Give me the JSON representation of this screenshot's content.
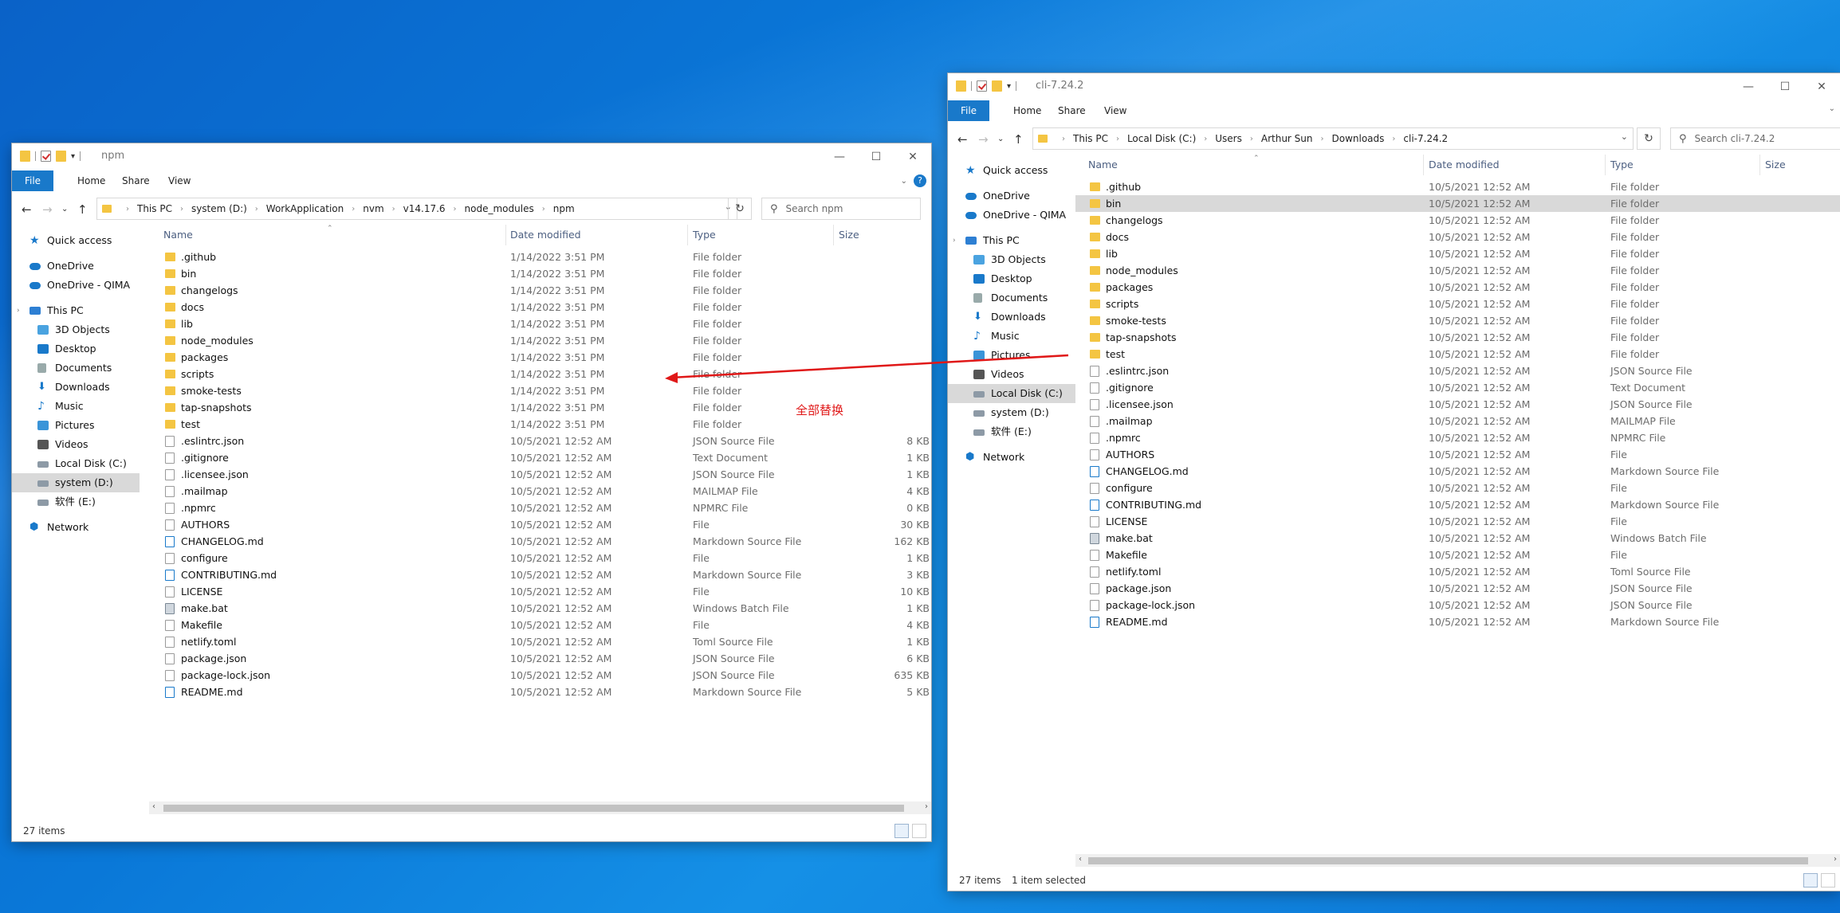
{
  "annotation": {
    "text": "全部替换"
  },
  "left_window": {
    "title": "npm",
    "ribbon_tabs": [
      "File",
      "Home",
      "Share",
      "View"
    ],
    "breadcrumb": [
      "This PC",
      "system (D:)",
      "WorkApplication",
      "nvm",
      "v14.17.6",
      "node_modules",
      "npm"
    ],
    "search_placeholder": "Search npm",
    "columns": [
      "Name",
      "Date modified",
      "Type",
      "Size"
    ],
    "status": "27 items",
    "nav": [
      {
        "label": "Quick access",
        "icon": "star-icon",
        "level": 0
      },
      {
        "label": "OneDrive",
        "icon": "cloud-icon",
        "level": 0
      },
      {
        "label": "OneDrive - QIMA",
        "icon": "cloud-icon",
        "level": 0
      },
      {
        "label": "This PC",
        "icon": "computer-icon",
        "level": 0
      },
      {
        "label": "3D Objects",
        "icon": "cube-icon",
        "level": 1
      },
      {
        "label": "Desktop",
        "icon": "desktop-icon",
        "level": 1
      },
      {
        "label": "Documents",
        "icon": "document-icon",
        "level": 1
      },
      {
        "label": "Downloads",
        "icon": "download-icon",
        "level": 1
      },
      {
        "label": "Music",
        "icon": "music-icon",
        "level": 1
      },
      {
        "label": "Pictures",
        "icon": "picture-icon",
        "level": 1
      },
      {
        "label": "Videos",
        "icon": "video-icon",
        "level": 1
      },
      {
        "label": "Local Disk (C:)",
        "icon": "drive-icon",
        "level": 1
      },
      {
        "label": "system (D:)",
        "icon": "drive-icon",
        "level": 1,
        "selected": true
      },
      {
        "label": "软件 (E:)",
        "icon": "drive-icon",
        "level": 1
      },
      {
        "label": "Network",
        "icon": "network-icon",
        "level": 0
      }
    ],
    "files": [
      {
        "name": ".github",
        "date": "1/14/2022 3:51 PM",
        "type": "File folder",
        "size": "",
        "kind": "folder"
      },
      {
        "name": "bin",
        "date": "1/14/2022 3:51 PM",
        "type": "File folder",
        "size": "",
        "kind": "folder"
      },
      {
        "name": "changelogs",
        "date": "1/14/2022 3:51 PM",
        "type": "File folder",
        "size": "",
        "kind": "folder"
      },
      {
        "name": "docs",
        "date": "1/14/2022 3:51 PM",
        "type": "File folder",
        "size": "",
        "kind": "folder"
      },
      {
        "name": "lib",
        "date": "1/14/2022 3:51 PM",
        "type": "File folder",
        "size": "",
        "kind": "folder"
      },
      {
        "name": "node_modules",
        "date": "1/14/2022 3:51 PM",
        "type": "File folder",
        "size": "",
        "kind": "folder"
      },
      {
        "name": "packages",
        "date": "1/14/2022 3:51 PM",
        "type": "File folder",
        "size": "",
        "kind": "folder"
      },
      {
        "name": "scripts",
        "date": "1/14/2022 3:51 PM",
        "type": "File folder",
        "size": "",
        "kind": "folder"
      },
      {
        "name": "smoke-tests",
        "date": "1/14/2022 3:51 PM",
        "type": "File folder",
        "size": "",
        "kind": "folder"
      },
      {
        "name": "tap-snapshots",
        "date": "1/14/2022 3:51 PM",
        "type": "File folder",
        "size": "",
        "kind": "folder"
      },
      {
        "name": "test",
        "date": "1/14/2022 3:51 PM",
        "type": "File folder",
        "size": "",
        "kind": "folder"
      },
      {
        "name": ".eslintrc.json",
        "date": "10/5/2021 12:52 AM",
        "type": "JSON Source File",
        "size": "8 KB",
        "kind": "json"
      },
      {
        "name": ".gitignore",
        "date": "10/5/2021 12:52 AM",
        "type": "Text Document",
        "size": "1 KB",
        "kind": "file"
      },
      {
        "name": ".licensee.json",
        "date": "10/5/2021 12:52 AM",
        "type": "JSON Source File",
        "size": "1 KB",
        "kind": "json"
      },
      {
        "name": ".mailmap",
        "date": "10/5/2021 12:52 AM",
        "type": "MAILMAP File",
        "size": "4 KB",
        "kind": "file"
      },
      {
        "name": ".npmrc",
        "date": "10/5/2021 12:52 AM",
        "type": "NPMRC File",
        "size": "0 KB",
        "kind": "file"
      },
      {
        "name": "AUTHORS",
        "date": "10/5/2021 12:52 AM",
        "type": "File",
        "size": "30 KB",
        "kind": "file"
      },
      {
        "name": "CHANGELOG.md",
        "date": "10/5/2021 12:52 AM",
        "type": "Markdown Source File",
        "size": "162 KB",
        "kind": "md"
      },
      {
        "name": "configure",
        "date": "10/5/2021 12:52 AM",
        "type": "File",
        "size": "1 KB",
        "kind": "file"
      },
      {
        "name": "CONTRIBUTING.md",
        "date": "10/5/2021 12:52 AM",
        "type": "Markdown Source File",
        "size": "3 KB",
        "kind": "md"
      },
      {
        "name": "LICENSE",
        "date": "10/5/2021 12:52 AM",
        "type": "File",
        "size": "10 KB",
        "kind": "file"
      },
      {
        "name": "make.bat",
        "date": "10/5/2021 12:52 AM",
        "type": "Windows Batch File",
        "size": "1 KB",
        "kind": "bat"
      },
      {
        "name": "Makefile",
        "date": "10/5/2021 12:52 AM",
        "type": "File",
        "size": "4 KB",
        "kind": "file"
      },
      {
        "name": "netlify.toml",
        "date": "10/5/2021 12:52 AM",
        "type": "Toml Source File",
        "size": "1 KB",
        "kind": "file"
      },
      {
        "name": "package.json",
        "date": "10/5/2021 12:52 AM",
        "type": "JSON Source File",
        "size": "6 KB",
        "kind": "json"
      },
      {
        "name": "package-lock.json",
        "date": "10/5/2021 12:52 AM",
        "type": "JSON Source File",
        "size": "635 KB",
        "kind": "json"
      },
      {
        "name": "README.md",
        "date": "10/5/2021 12:52 AM",
        "type": "Markdown Source File",
        "size": "5 KB",
        "kind": "md"
      }
    ]
  },
  "right_window": {
    "title": "cli-7.24.2",
    "ribbon_tabs": [
      "File",
      "Home",
      "Share",
      "View"
    ],
    "breadcrumb": [
      "This PC",
      "Local Disk (C:)",
      "Users",
      "Arthur Sun",
      "Downloads",
      "cli-7.24.2"
    ],
    "search_placeholder": "Search cli-7.24.2",
    "columns": [
      "Name",
      "Date modified",
      "Type",
      "Size"
    ],
    "status": "27 items",
    "status_selected": "1 item selected",
    "nav": [
      {
        "label": "Quick access",
        "icon": "star-icon",
        "level": 0
      },
      {
        "label": "OneDrive",
        "icon": "cloud-icon",
        "level": 0
      },
      {
        "label": "OneDrive - QIMA",
        "icon": "cloud-icon",
        "level": 0
      },
      {
        "label": "This PC",
        "icon": "computer-icon",
        "level": 0
      },
      {
        "label": "3D Objects",
        "icon": "cube-icon",
        "level": 1
      },
      {
        "label": "Desktop",
        "icon": "desktop-icon",
        "level": 1
      },
      {
        "label": "Documents",
        "icon": "document-icon",
        "level": 1
      },
      {
        "label": "Downloads",
        "icon": "download-icon",
        "level": 1
      },
      {
        "label": "Music",
        "icon": "music-icon",
        "level": 1
      },
      {
        "label": "Pictures",
        "icon": "picture-icon",
        "level": 1
      },
      {
        "label": "Videos",
        "icon": "video-icon",
        "level": 1
      },
      {
        "label": "Local Disk (C:)",
        "icon": "drive-icon",
        "level": 1,
        "selected": true
      },
      {
        "label": "system (D:)",
        "icon": "drive-icon",
        "level": 1
      },
      {
        "label": "软件 (E:)",
        "icon": "drive-icon",
        "level": 1
      },
      {
        "label": "Network",
        "icon": "network-icon",
        "level": 0
      }
    ],
    "files": [
      {
        "name": ".github",
        "date": "10/5/2021 12:52 AM",
        "type": "File folder",
        "kind": "folder"
      },
      {
        "name": "bin",
        "date": "10/5/2021 12:52 AM",
        "type": "File folder",
        "kind": "folder",
        "selected": true
      },
      {
        "name": "changelogs",
        "date": "10/5/2021 12:52 AM",
        "type": "File folder",
        "kind": "folder"
      },
      {
        "name": "docs",
        "date": "10/5/2021 12:52 AM",
        "type": "File folder",
        "kind": "folder"
      },
      {
        "name": "lib",
        "date": "10/5/2021 12:52 AM",
        "type": "File folder",
        "kind": "folder"
      },
      {
        "name": "node_modules",
        "date": "10/5/2021 12:52 AM",
        "type": "File folder",
        "kind": "folder"
      },
      {
        "name": "packages",
        "date": "10/5/2021 12:52 AM",
        "type": "File folder",
        "kind": "folder"
      },
      {
        "name": "scripts",
        "date": "10/5/2021 12:52 AM",
        "type": "File folder",
        "kind": "folder"
      },
      {
        "name": "smoke-tests",
        "date": "10/5/2021 12:52 AM",
        "type": "File folder",
        "kind": "folder"
      },
      {
        "name": "tap-snapshots",
        "date": "10/5/2021 12:52 AM",
        "type": "File folder",
        "kind": "folder"
      },
      {
        "name": "test",
        "date": "10/5/2021 12:52 AM",
        "type": "File folder",
        "kind": "folder"
      },
      {
        "name": ".eslintrc.json",
        "date": "10/5/2021 12:52 AM",
        "type": "JSON Source File",
        "kind": "json"
      },
      {
        "name": ".gitignore",
        "date": "10/5/2021 12:52 AM",
        "type": "Text Document",
        "kind": "file"
      },
      {
        "name": ".licensee.json",
        "date": "10/5/2021 12:52 AM",
        "type": "JSON Source File",
        "kind": "json"
      },
      {
        "name": ".mailmap",
        "date": "10/5/2021 12:52 AM",
        "type": "MAILMAP File",
        "kind": "file"
      },
      {
        "name": ".npmrc",
        "date": "10/5/2021 12:52 AM",
        "type": "NPMRC File",
        "kind": "file"
      },
      {
        "name": "AUTHORS",
        "date": "10/5/2021 12:52 AM",
        "type": "File",
        "kind": "file"
      },
      {
        "name": "CHANGELOG.md",
        "date": "10/5/2021 12:52 AM",
        "type": "Markdown Source File",
        "kind": "md"
      },
      {
        "name": "configure",
        "date": "10/5/2021 12:52 AM",
        "type": "File",
        "kind": "file"
      },
      {
        "name": "CONTRIBUTING.md",
        "date": "10/5/2021 12:52 AM",
        "type": "Markdown Source File",
        "kind": "md"
      },
      {
        "name": "LICENSE",
        "date": "10/5/2021 12:52 AM",
        "type": "File",
        "kind": "file"
      },
      {
        "name": "make.bat",
        "date": "10/5/2021 12:52 AM",
        "type": "Windows Batch File",
        "kind": "bat"
      },
      {
        "name": "Makefile",
        "date": "10/5/2021 12:52 AM",
        "type": "File",
        "kind": "file"
      },
      {
        "name": "netlify.toml",
        "date": "10/5/2021 12:52 AM",
        "type": "Toml Source File",
        "kind": "file"
      },
      {
        "name": "package.json",
        "date": "10/5/2021 12:52 AM",
        "type": "JSON Source File",
        "kind": "json"
      },
      {
        "name": "package-lock.json",
        "date": "10/5/2021 12:52 AM",
        "type": "JSON Source File",
        "kind": "json"
      },
      {
        "name": "README.md",
        "date": "10/5/2021 12:52 AM",
        "type": "Markdown Source File",
        "kind": "md"
      }
    ]
  },
  "colors": {
    "ribbon_file": "#1979ca",
    "selection": "#d9d9d9",
    "folder": "#f4c542",
    "annotation": "#e01818"
  }
}
